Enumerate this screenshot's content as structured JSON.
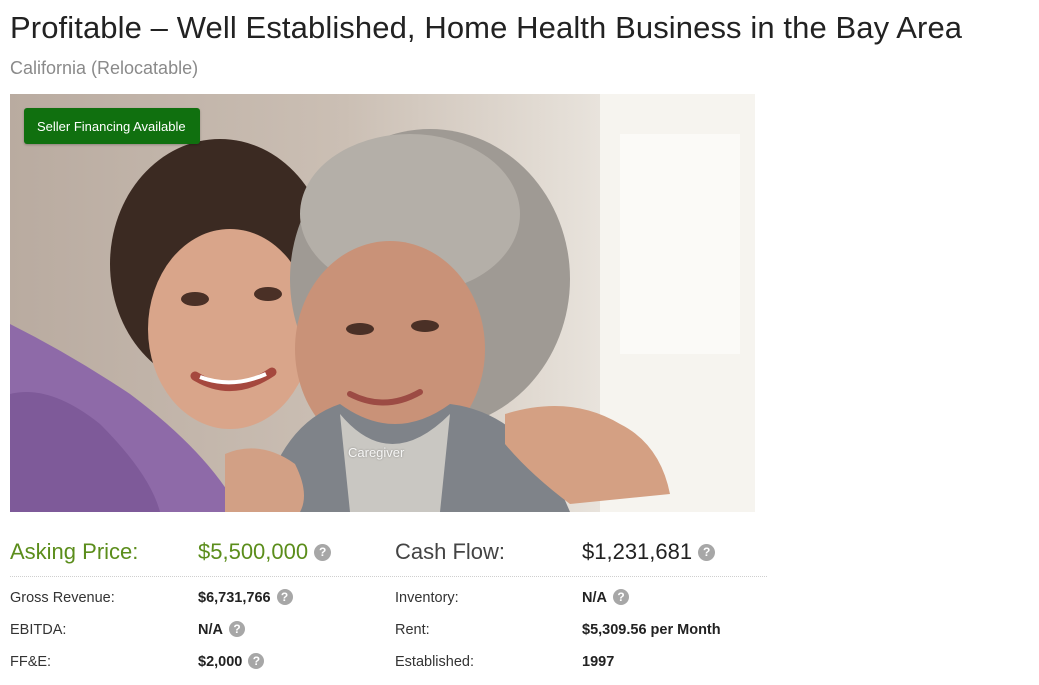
{
  "listing": {
    "title": "Profitable – Well Established, Home Health Business in the Bay Area",
    "location": "California (Relocatable)",
    "badge": "Seller Financing Available",
    "image_caption": "Caregiver",
    "help_icon": "?"
  },
  "financials": {
    "asking_price": {
      "label": "Asking Price:",
      "value": "$5,500,000"
    },
    "cash_flow": {
      "label": "Cash Flow:",
      "value": "$1,231,681"
    },
    "gross_revenue": {
      "label": "Gross Revenue:",
      "value": "$6,731,766"
    },
    "ebitda": {
      "label": "EBITDA:",
      "value": "N/A"
    },
    "ffe": {
      "label": "FF&E:",
      "value": "$2,000"
    },
    "inventory": {
      "label": "Inventory:",
      "value": "N/A"
    },
    "rent": {
      "label": "Rent:",
      "value": "$5,309.56 per Month"
    },
    "established": {
      "label": "Established:",
      "value": "1997"
    }
  },
  "colors": {
    "accent_green": "#5b8d1b",
    "badge_green": "#10700f",
    "help_icon_gray": "#a7a7a7"
  },
  "icons": [
    "question-help-icon"
  ]
}
